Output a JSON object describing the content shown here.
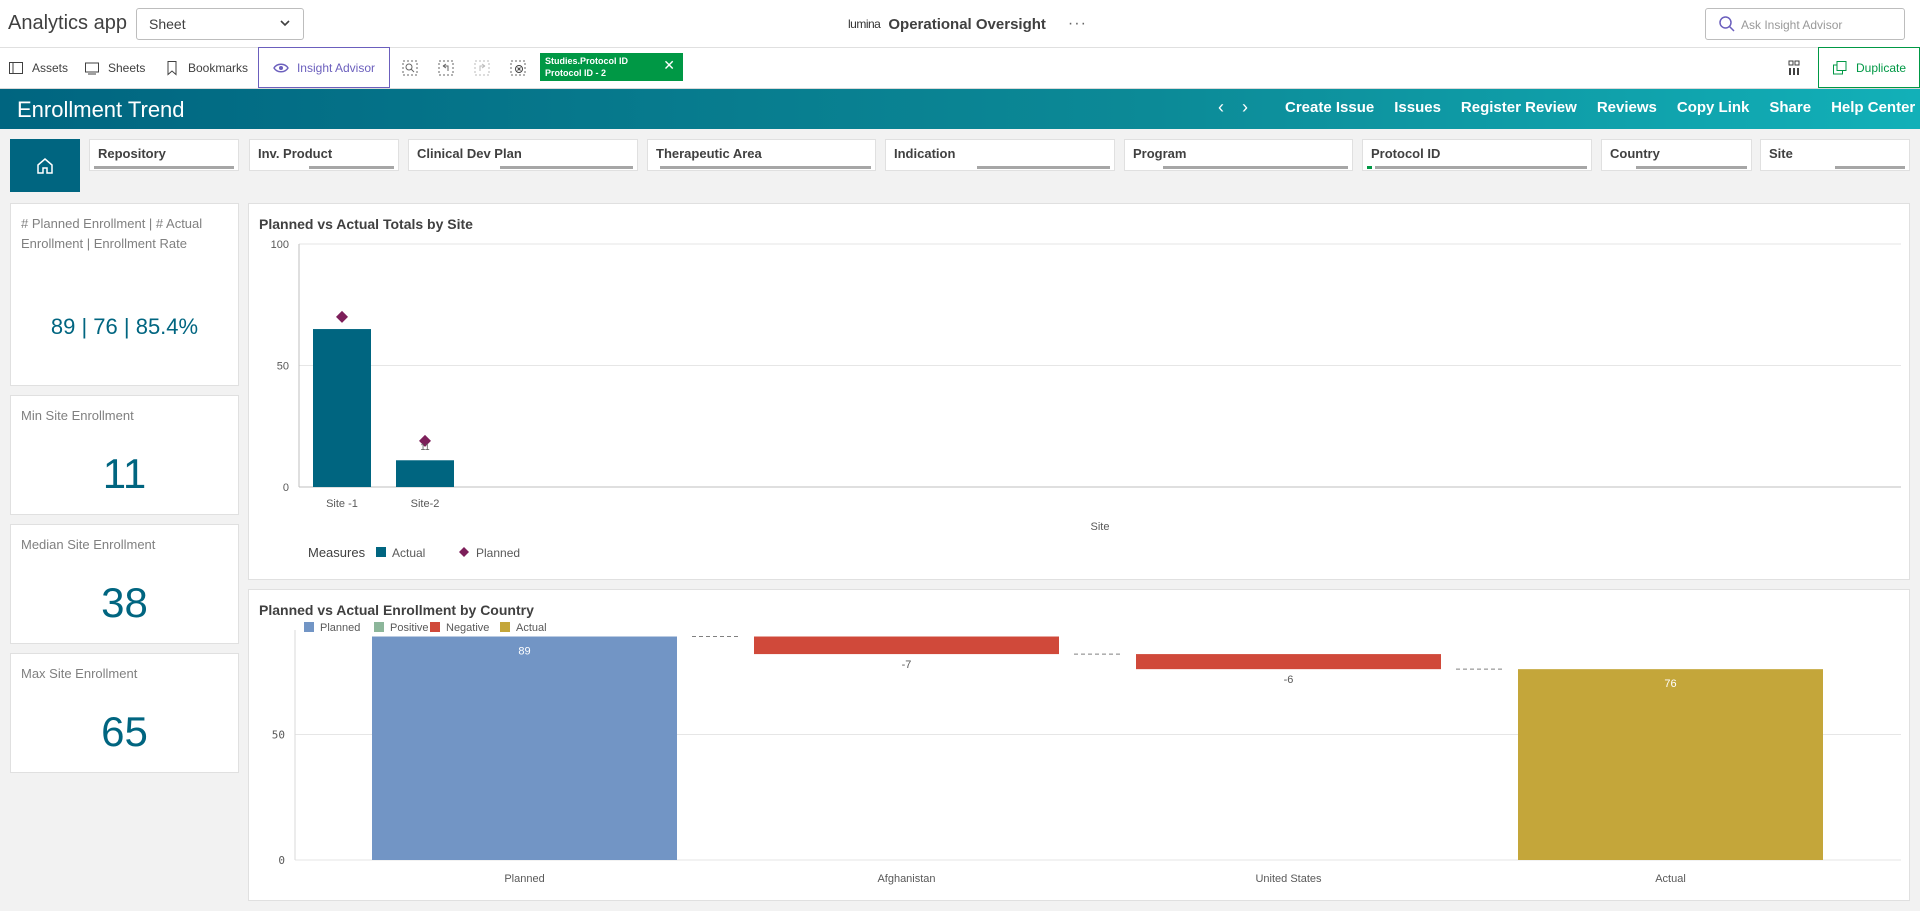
{
  "app": {
    "title": "Analytics app",
    "sheet_select": "Sheet",
    "center_logo": "lumina",
    "center_title": "Operational Oversight",
    "more": "···",
    "ask_placeholder": "Ask Insight Advisor"
  },
  "toolbar": {
    "assets": "Assets",
    "sheets": "Sheets",
    "bookmarks": "Bookmarks",
    "insight": "Insight Advisor",
    "chip_line1": "Studies.Protocol ID",
    "chip_line2": "Protocol ID - 2",
    "chip_close": "✕",
    "duplicate": "Duplicate",
    "colors": {
      "accent_purple": "#6b5fbd",
      "selection_green": "#009845"
    }
  },
  "header": {
    "title": "Enrollment Trend",
    "prev": "‹",
    "next": "›",
    "links": [
      "Create Issue",
      "Issues",
      "Register Review",
      "Reviews",
      "Copy Link",
      "Share",
      "Help Center"
    ]
  },
  "filters": [
    "Repository",
    "Inv. Product",
    "Clinical Dev Plan",
    "Therapeutic Area",
    "Indication",
    "Program",
    "Protocol ID",
    "Country",
    "Site"
  ],
  "kpis": [
    {
      "label": "# Planned Enrollment | # Actual Enrollment | Enrollment Rate",
      "value": "89 | 76 | 85.4%"
    },
    {
      "label": "Min Site Enrollment",
      "value": "11"
    },
    {
      "label": "Median Site Enrollment",
      "value": "38"
    },
    {
      "label": "Max Site Enrollment",
      "value": "65"
    }
  ],
  "chart_data": [
    {
      "type": "bar",
      "title": "Planned vs Actual Totals by Site",
      "xlabel": "Site",
      "ylabel": "",
      "ylim": [
        0,
        100
      ],
      "yticks": [
        0,
        50,
        100
      ],
      "categories": [
        "Site -1",
        "Site-2"
      ],
      "series": [
        {
          "name": "Actual",
          "kind": "bar",
          "color": "#006580",
          "values": [
            65,
            11
          ],
          "labels": [
            "",
            "11"
          ]
        },
        {
          "name": "Planned",
          "kind": "marker",
          "color": "#7d1f5a",
          "values": [
            70,
            19
          ]
        }
      ],
      "legend_title": "Measures",
      "legend": "bottom-left"
    },
    {
      "type": "bar",
      "subtype": "waterfall",
      "title": "Planned vs Actual Enrollment by Country",
      "ylim": [
        0,
        90
      ],
      "yticks": [
        0,
        50
      ],
      "categories": [
        "Planned",
        "Afghanistan",
        "United States",
        "Actual"
      ],
      "values": [
        89,
        -7,
        -6,
        76
      ],
      "labels": [
        "89",
        "-7",
        "-6",
        "76"
      ],
      "legend": [
        {
          "name": "Planned",
          "color": "#7295c5"
        },
        {
          "name": "Positive",
          "color": "#8cb69a"
        },
        {
          "name": "Negative",
          "color": "#d0493a"
        },
        {
          "name": "Actual",
          "color": "#c4a63a"
        }
      ],
      "legend_placement": "top-left"
    }
  ]
}
